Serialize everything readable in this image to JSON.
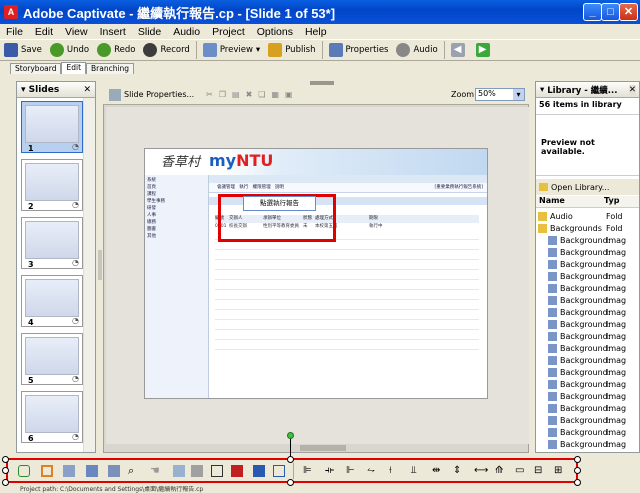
{
  "window": {
    "title": "Adobe Captivate - 繼續執行報告.cp - [Slide 1 of 53*]",
    "app_icon_label": "A",
    "minimize": "_",
    "maximize": "□",
    "close": "✕"
  },
  "menu": [
    "File",
    "Edit",
    "View",
    "Insert",
    "Slide",
    "Audio",
    "Project",
    "Options",
    "Help"
  ],
  "toolbar": {
    "save": "Save",
    "undo": "Undo",
    "redo": "Redo",
    "record": "Record",
    "preview": "Preview",
    "publish": "Publish",
    "properties": "Properties",
    "audio": "Audio"
  },
  "tabs": [
    "Storyboard",
    "Edit",
    "Branching"
  ],
  "slides_panel": {
    "title": "Slides",
    "thumbnails": [
      {
        "number": "1",
        "selected": true
      },
      {
        "number": "2",
        "selected": false
      },
      {
        "number": "3",
        "selected": false
      },
      {
        "number": "4",
        "selected": false
      },
      {
        "number": "5",
        "selected": false
      },
      {
        "number": "6",
        "selected": false
      }
    ]
  },
  "editor": {
    "slide_properties": "Slide Properties...",
    "zoom_label": "Zoom:",
    "zoom_value": "50%"
  },
  "slide_content": {
    "logo_text": "香草村",
    "site_name_my": "my",
    "site_name_ntu": "NTU",
    "popup_text": "點選執行報告",
    "nav_items": [
      "會議管理",
      "執行",
      "權限管理",
      "說明"
    ],
    "page_header": "[重要業務執行報告系統]",
    "left_menu": [
      "系統",
      "首頁",
      "課程",
      "學生事務",
      "研發",
      "人事",
      "總務",
      "圖書",
      "其他"
    ],
    "table_headers": [
      "編號",
      "交辦人",
      "承辦單位",
      "狀態",
      "處理方式",
      "期限"
    ],
    "table_row": [
      "0001",
      "校長交辦",
      "性別平等教育委員",
      "未",
      "本校第五屆",
      "執行中"
    ]
  },
  "library": {
    "title": "Library - 繼續...",
    "count_text": "56 items in library",
    "preview_text": "Preview not available.",
    "open_library": "Open Library...",
    "col_name": "Name",
    "col_type": "Typ",
    "items": [
      {
        "name": "Audio",
        "type": "Fold",
        "kind": "folder"
      },
      {
        "name": "Backgrounds",
        "type": "Fold",
        "kind": "folder"
      },
      {
        "name": "Background:",
        "type": "Imag",
        "kind": "image"
      },
      {
        "name": "Background:",
        "type": "Imag",
        "kind": "image"
      },
      {
        "name": "Background:",
        "type": "Imag",
        "kind": "image"
      },
      {
        "name": "Background:",
        "type": "Imag",
        "kind": "image"
      },
      {
        "name": "Background:",
        "type": "Imag",
        "kind": "image"
      },
      {
        "name": "Background:",
        "type": "Imag",
        "kind": "image"
      },
      {
        "name": "Background:",
        "type": "Imag",
        "kind": "image"
      },
      {
        "name": "Background:",
        "type": "Imag",
        "kind": "image"
      },
      {
        "name": "Background:",
        "type": "Imag",
        "kind": "image"
      },
      {
        "name": "Background:",
        "type": "Imag",
        "kind": "image"
      },
      {
        "name": "Background:",
        "type": "Imag",
        "kind": "image"
      },
      {
        "name": "Background:",
        "type": "Imag",
        "kind": "image"
      },
      {
        "name": "Background:",
        "type": "Imag",
        "kind": "image"
      },
      {
        "name": "Background:",
        "type": "Imag",
        "kind": "image"
      },
      {
        "name": "Background:",
        "type": "Imag",
        "kind": "image"
      },
      {
        "name": "Background:",
        "type": "Imag",
        "kind": "image"
      },
      {
        "name": "Background:",
        "type": "Imag",
        "kind": "image"
      },
      {
        "name": "Background:",
        "type": "Imag",
        "kind": "image"
      }
    ]
  },
  "status_bar": "Project path: C:\\Documents and Settings\\桌面\\繼續執行報告.cp"
}
